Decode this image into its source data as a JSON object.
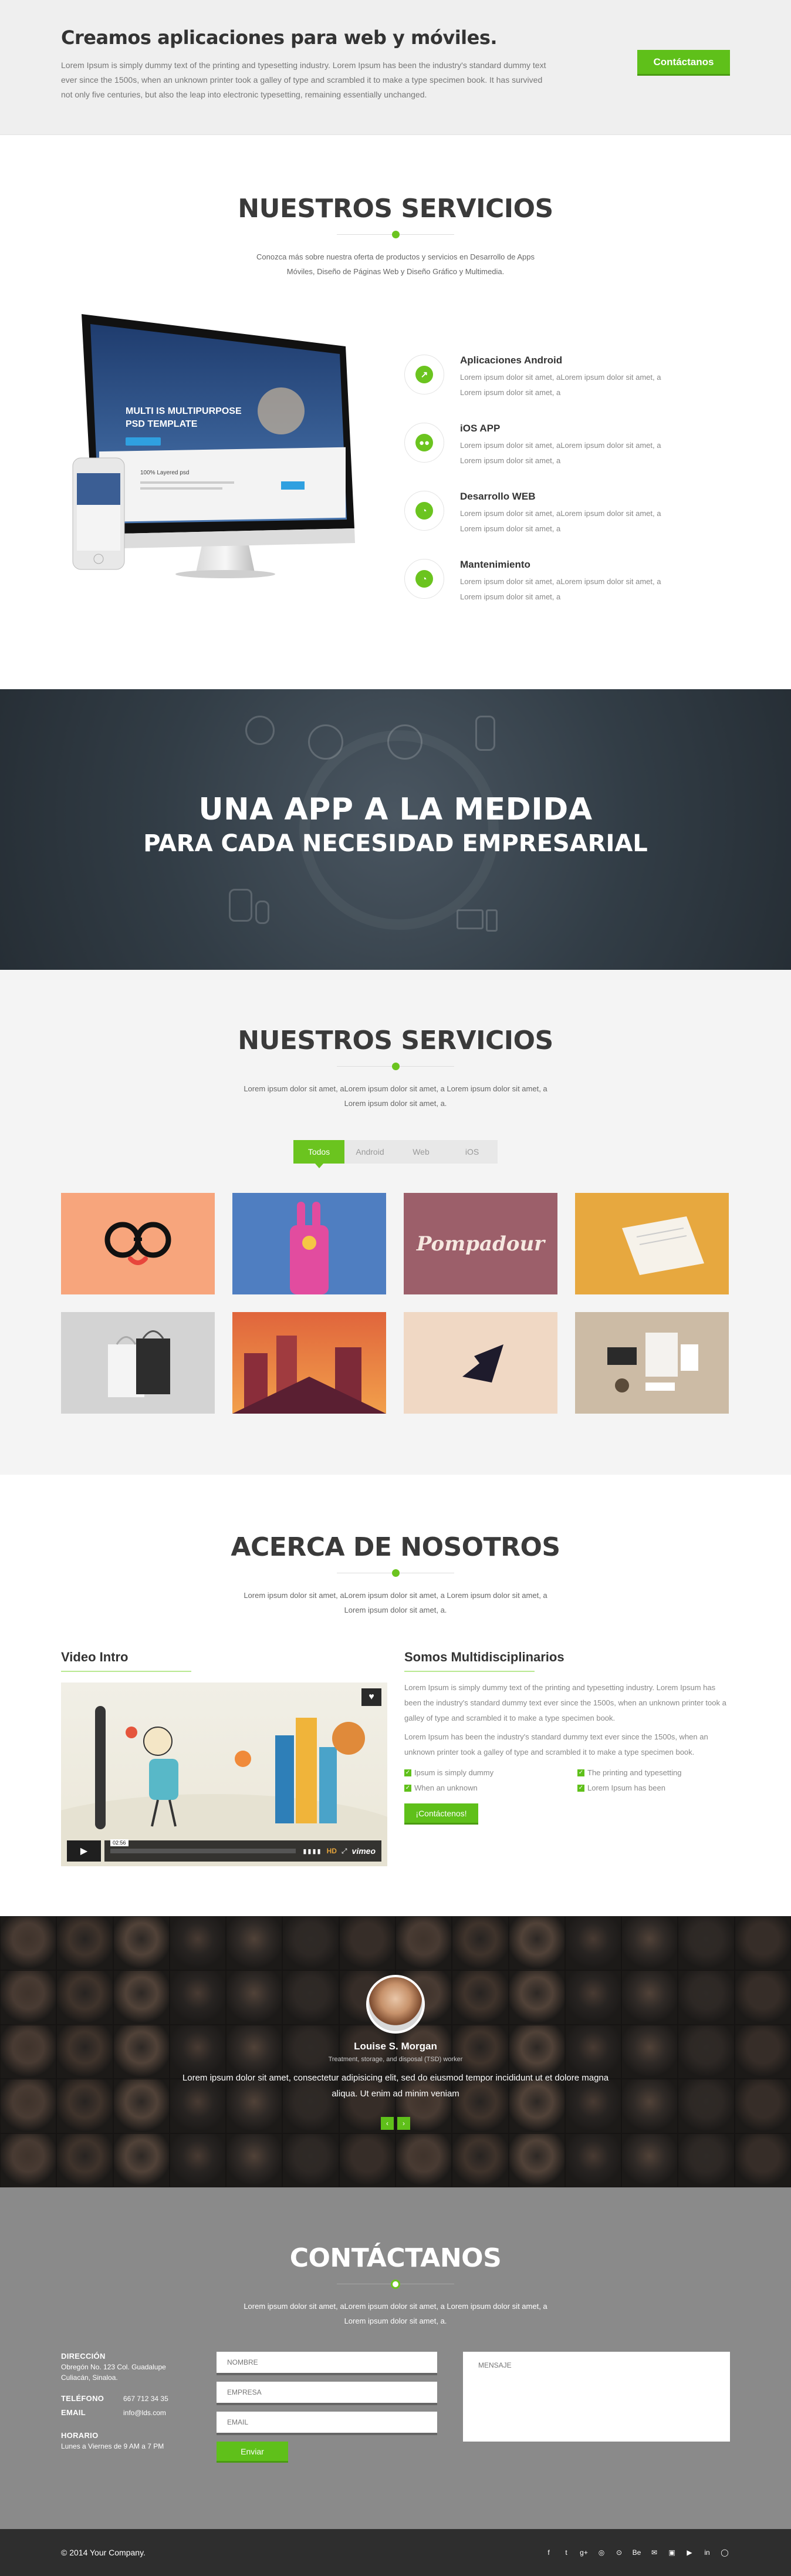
{
  "hero": {
    "title": "Creamos aplicaciones para web y móviles.",
    "text": "Lorem Ipsum is simply dummy text of the printing and typesetting industry. Lorem Ipsum has been the industry's standard dummy text ever since the 1500s, when an unknown printer took a galley of type and scrambled it to make a type specimen book. It has survived not only five centuries, but also the leap into electronic typesetting, remaining essentially unchanged.",
    "cta": "Contáctanos"
  },
  "services": {
    "title": "NUESTROS SERVICIOS",
    "lead": "Conozca más sobre nuestra oferta de productos y servicios en Desarrollo de Apps Móviles, Diseño de Páginas Web y Diseño Gráfico y Multimedia.",
    "mockup": {
      "headline1": "MULTI IS MULTIPURPOSE",
      "headline2": "PSD TEMPLATE",
      "heading": "100% Layered psd"
    },
    "items": [
      {
        "icon": "chart-line-icon",
        "title": "Aplicaciones Android",
        "text": "Lorem ipsum dolor sit amet, aLorem ipsum dolor sit amet, a Lorem ipsum dolor sit amet, a"
      },
      {
        "icon": "users-icon",
        "title": "iOS APP",
        "text": "Lorem ipsum dolor sit amet, aLorem ipsum dolor sit amet, a Lorem ipsum dolor sit amet, a"
      },
      {
        "icon": "pie-chart-icon",
        "title": "Desarrollo WEB",
        "text": "Lorem ipsum dolor sit amet, aLorem ipsum dolor sit amet, a Lorem ipsum dolor sit amet, a"
      },
      {
        "icon": "pie-chart-icon",
        "title": "Mantenimiento",
        "text": "Lorem ipsum dolor sit amet, aLorem ipsum dolor sit amet, a Lorem ipsum dolor sit amet, a"
      }
    ]
  },
  "banner": {
    "line1": "UNA APP A LA MEDIDA",
    "line2": "PARA CADA NECESIDAD EMPRESARIAL"
  },
  "portfolio": {
    "title": "NUESTROS SERVICIOS",
    "lead": "Lorem ipsum dolor sit amet, aLorem ipsum dolor sit amet, a Lorem ipsum dolor sit amet, a Lorem ipsum dolor sit amet, a.",
    "filters": [
      "Todos",
      "Android",
      "Web",
      "iOS"
    ],
    "tiles": [
      {
        "name": "glasses",
        "color": "#f7a57c"
      },
      {
        "name": "pink-rabbit",
        "color": "#4f7ec1"
      },
      {
        "name": "pompadour",
        "color": "#9c5f6a",
        "label": "Pompadour"
      },
      {
        "name": "paper",
        "color": "#e7a83f"
      },
      {
        "name": "bags",
        "color": "#d3d3d3"
      },
      {
        "name": "city",
        "color": "#e0653c"
      },
      {
        "name": "plane",
        "color": "#f0d8c4"
      },
      {
        "name": "stationery",
        "color": "#ccbba5"
      }
    ]
  },
  "about": {
    "title": "ACERCA DE NOSOTROS",
    "lead": "Lorem ipsum dolor sit amet, aLorem ipsum dolor sit amet, a Lorem ipsum dolor sit amet, a Lorem ipsum dolor sit amet, a.",
    "video_title": "Video Intro",
    "video_time": "02:56",
    "video_brand": "vimeo",
    "video_hd": "HD",
    "col_title": "Somos Multidisciplinarios",
    "p1": "Lorem Ipsum is simply dummy text of the printing and typesetting industry. Lorem Ipsum has been the industry's standard dummy text ever since the 1500s, when an unknown printer took a galley of type and scrambled it to make a type specimen book.",
    "p2": "Lorem Ipsum has been the industry's standard dummy text ever since the 1500s, when an unknown printer took a galley of type and scrambled it to make a type specimen book.",
    "checks": [
      "Ipsum is simply dummy",
      "The printing and typesetting",
      "When an unknown",
      "Lorem Ipsum has been"
    ],
    "button": "¡Contáctenos!"
  },
  "testimonial": {
    "name": "Louise S. Morgan",
    "role": "Treatment, storage, and disposal (TSD) worker",
    "quote": "Lorem ipsum dolor sit amet, consectetur adipisicing elit, sed do eiusmod tempor incididunt ut et dolore magna aliqua. Ut enim ad minim veniam",
    "prev": "‹",
    "next": "›"
  },
  "contact": {
    "title": "CONTÁCTANOS",
    "lead": "Lorem ipsum dolor sit amet, aLorem ipsum dolor sit amet, a Lorem ipsum dolor sit amet, a Lorem ipsum dolor sit amet, a.",
    "address_label": "DIRECCIÓN",
    "address": "Obregón No. 123 Col. Guadalupe Culiacán, Sinaloa.",
    "phone_label": "TELÉFONO",
    "phone": "667 712 34 35",
    "email_label": "EMAIL",
    "email": "info@lds.com",
    "hours_label": "HORARIO",
    "hours": "Lunes a Viernes de 9 AM a 7 PM",
    "form": {
      "name_ph": "NOMBRE",
      "company_ph": "EMPRESA",
      "email_ph": "EMAIL",
      "message_ph": "MENSAJE",
      "send": "Enviar"
    }
  },
  "footer": {
    "copyright": "© 2014 Your Company.",
    "social": [
      "f",
      "t",
      "g+",
      "◎",
      "⊙",
      "Be",
      "✉",
      "▣",
      "▶",
      "in",
      "◯"
    ]
  },
  "colors": {
    "accent": "#6bc41f",
    "dark": "#2e2e2e",
    "contact_bg": "#8a8a8a"
  }
}
